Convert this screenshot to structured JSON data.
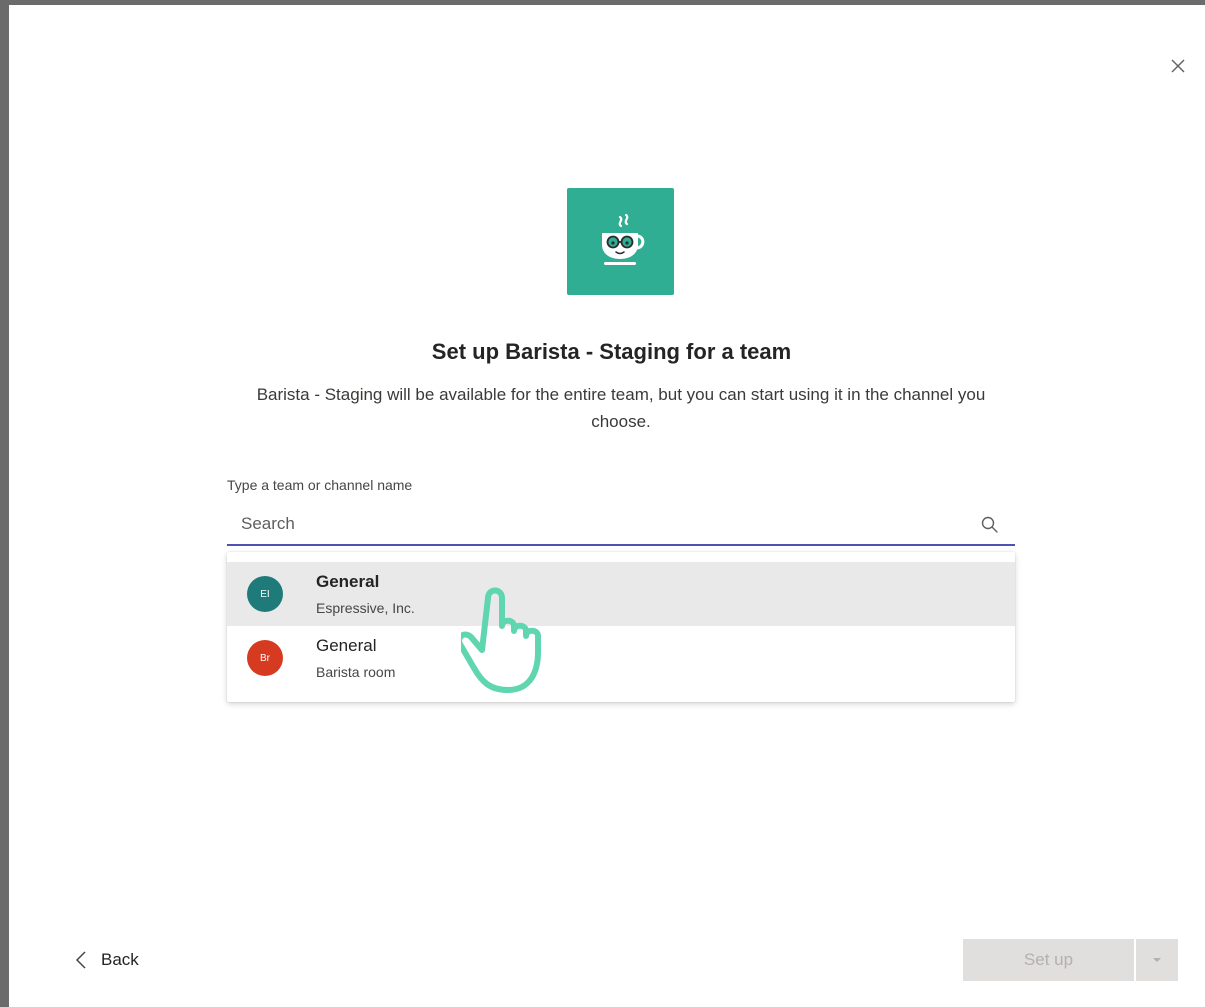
{
  "dialog": {
    "title": "Set up Barista - Staging for a team",
    "description": "Barista - Staging will be available for the entire team, but you can start using it in the channel you choose.",
    "app_icon": "coffee-cup-glasses-icon",
    "accent_color": "#2fae93"
  },
  "search": {
    "label": "Type a team or channel name",
    "placeholder": "Search",
    "value": ""
  },
  "results": [
    {
      "channel": "General",
      "team": "Espressive, Inc.",
      "initials": "EI",
      "avatar_color": "#1f7a7a",
      "hovered": true
    },
    {
      "channel": "General",
      "team": "Barista room",
      "initials": "Br",
      "avatar_color": "#d63a20",
      "hovered": false
    }
  ],
  "footer": {
    "back_label": "Back",
    "setup_label": "Set up"
  }
}
